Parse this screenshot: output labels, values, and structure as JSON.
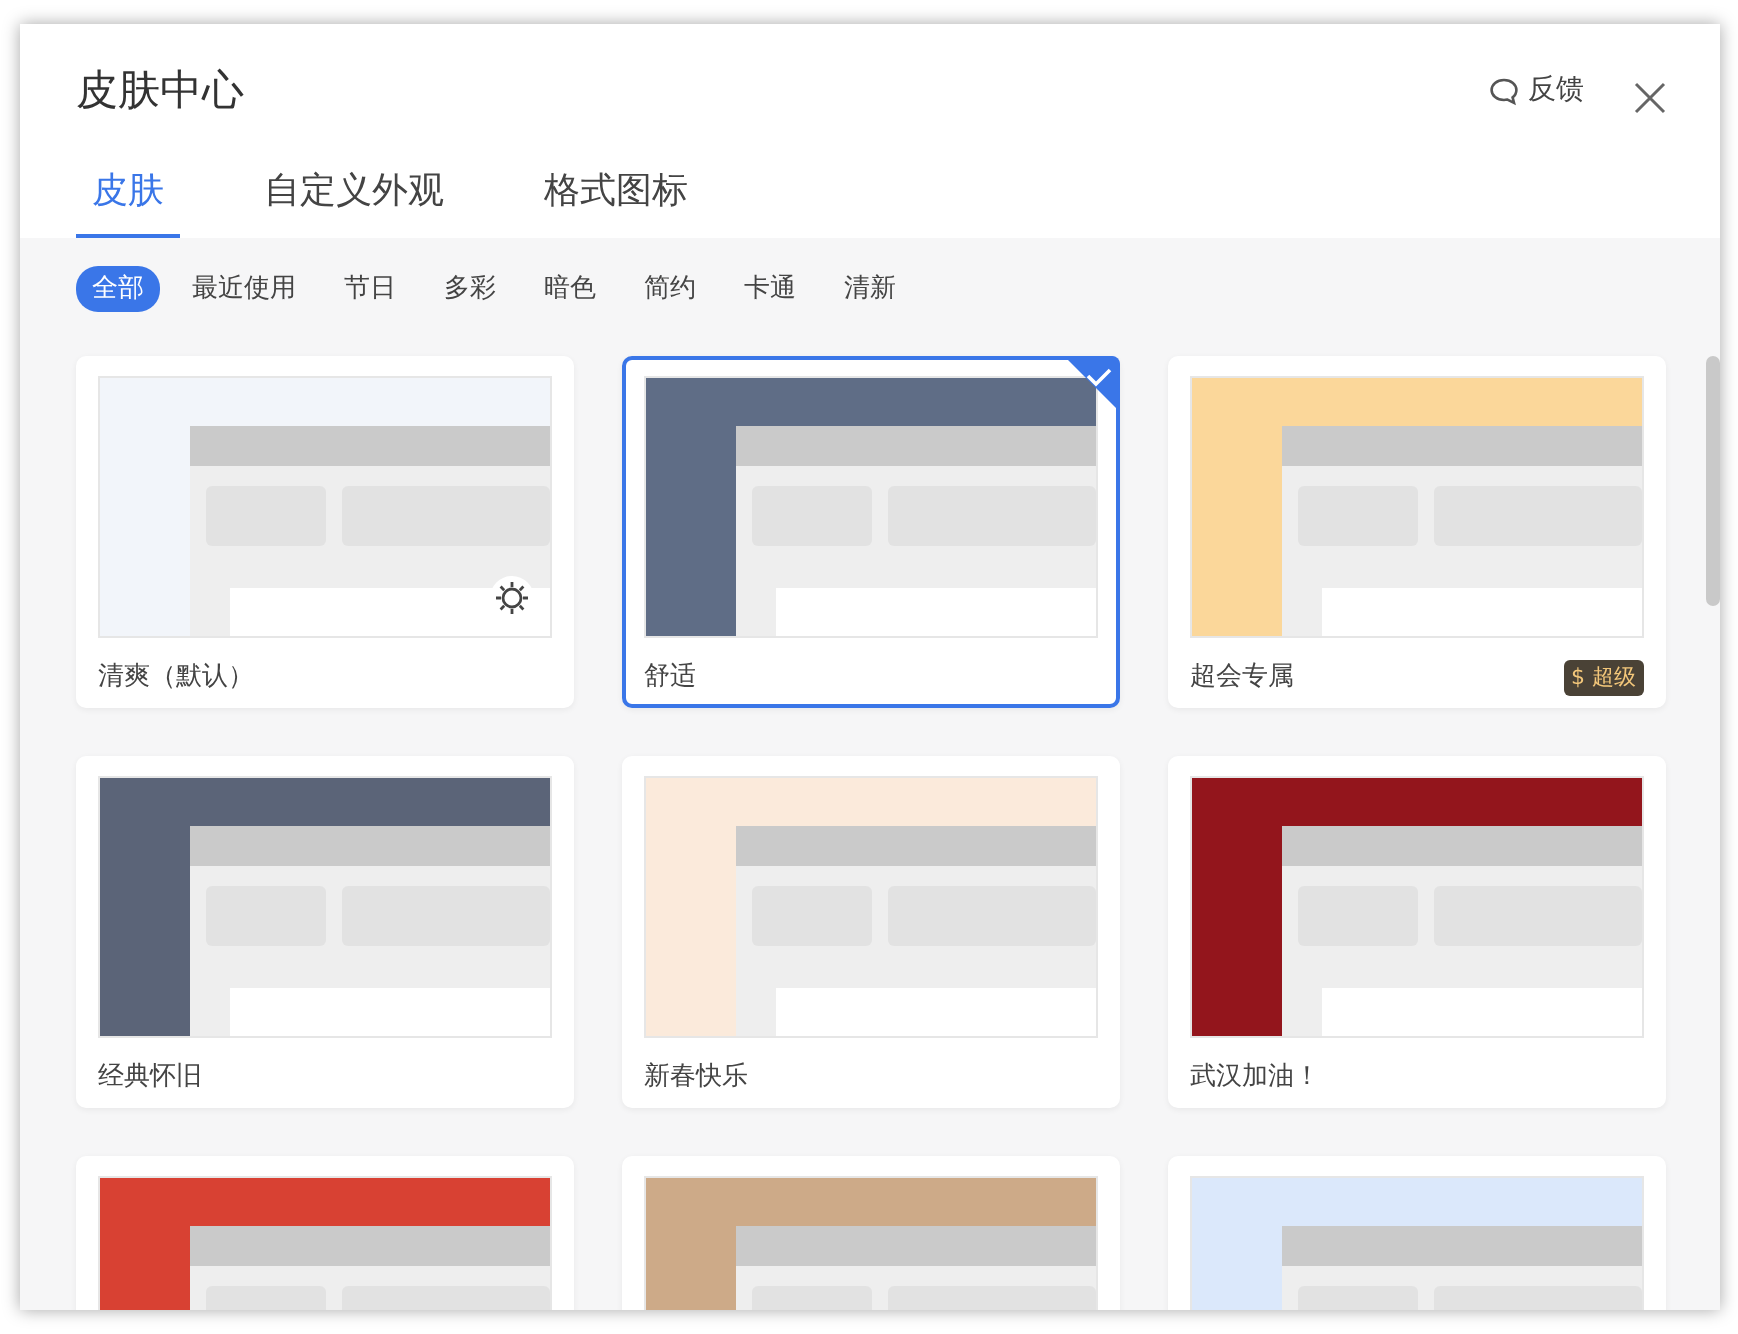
{
  "window": {
    "title": "皮肤中心",
    "feedback": "反馈"
  },
  "tabs": [
    {
      "label": "皮肤",
      "selected": true
    },
    {
      "label": "自定义外观",
      "selected": false
    },
    {
      "label": "格式图标",
      "selected": false
    }
  ],
  "filters": [
    {
      "label": "全部",
      "selected": true
    },
    {
      "label": "最近使用",
      "selected": false
    },
    {
      "label": "节日",
      "selected": false
    },
    {
      "label": "多彩",
      "selected": false
    },
    {
      "label": "暗色",
      "selected": false
    },
    {
      "label": "简约",
      "selected": false
    },
    {
      "label": "卡通",
      "selected": false
    },
    {
      "label": "清新",
      "selected": false
    }
  ],
  "skins": [
    {
      "name": "清爽（默认）",
      "selected": false,
      "color": "#f2f5fa",
      "mode_toggle": true
    },
    {
      "name": "舒适",
      "selected": true,
      "color": "#5f6d86"
    },
    {
      "name": "超会专属",
      "selected": false,
      "color": "#fbd79a",
      "badge": "$ 超级"
    },
    {
      "name": "经典怀旧",
      "selected": false,
      "color": "#5b6478"
    },
    {
      "name": "新春快乐",
      "selected": false,
      "color": "#fbeadb"
    },
    {
      "name": "武汉加油！",
      "selected": false,
      "color": "#93151c"
    },
    {
      "selected": false,
      "color": "#d84133"
    },
    {
      "selected": false,
      "color": "#cdaa88"
    },
    {
      "selected": false,
      "color": "#dbe8fb"
    }
  ]
}
